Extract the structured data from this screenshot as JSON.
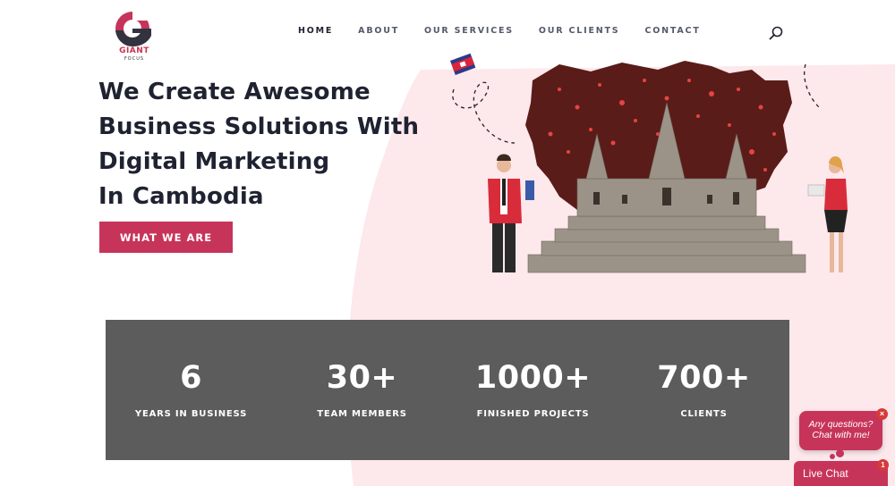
{
  "brand": {
    "logo_text": "GIANT",
    "logo_sub": "FOCUS",
    "primary_color": "#c7345a",
    "logo_dark": "#333340"
  },
  "nav": {
    "items": [
      {
        "label": "HOME",
        "active": true
      },
      {
        "label": "ABOUT",
        "active": false
      },
      {
        "label": "OUR SERVICES",
        "active": false
      },
      {
        "label": "OUR CLIENTS",
        "active": false
      },
      {
        "label": "CONTACT",
        "active": false
      }
    ],
    "search_icon": "search-icon"
  },
  "hero": {
    "headline_lines": [
      "We Create Awesome",
      "Business Solutions With",
      "Digital Marketing",
      "In Cambodia"
    ],
    "cta_label": "WHAT WE ARE",
    "bg_pink": "#fde8ec"
  },
  "stats": {
    "items": [
      {
        "number": "6",
        "label": "YEARS IN BUSINESS"
      },
      {
        "number": "30+",
        "label": "TEAM MEMBERS"
      },
      {
        "number": "1000+",
        "label": "FINISHED PROJECTS"
      },
      {
        "number": "700+",
        "label": "CLIENTS"
      }
    ],
    "bg_color": "#5c5c5c"
  },
  "chat": {
    "bubble_line1": "Any questions?",
    "bubble_line2": "Chat with me!",
    "close_glyph": "×",
    "live_chat_label": "Live Chat",
    "unread_count": "1"
  }
}
